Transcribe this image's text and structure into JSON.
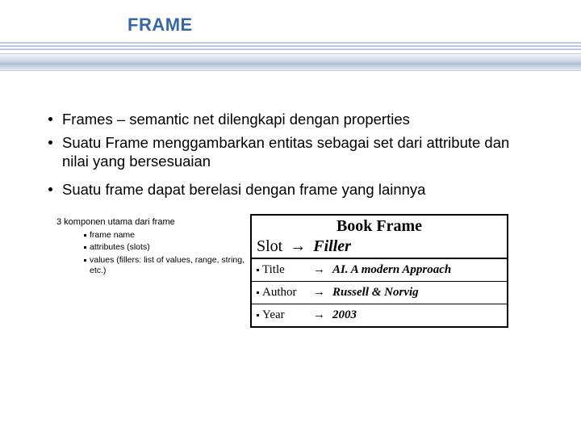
{
  "title": "FRAME",
  "bullets": [
    "Frames – semantic net dilengkapi dengan properties",
    "Suatu Frame menggambarkan entitas sebagai set dari attribute dan nilai yang bersesuaian",
    "Suatu frame dapat berelasi dengan frame yang lainnya"
  ],
  "components": {
    "heading": "3 komponen utama dari frame",
    "items": [
      "frame name",
      "attributes (slots)",
      "values (fillers: list of values, range, string, etc.)"
    ]
  },
  "box": {
    "title": "Book Frame",
    "header": {
      "slot": "Slot",
      "arrow": "→",
      "filler": "Filler"
    },
    "rows": [
      {
        "slot": "Title",
        "arrow": "→",
        "filler": "AI. A modern Approach"
      },
      {
        "slot": "Author",
        "arrow": "→",
        "filler": "Russell & Norvig"
      },
      {
        "slot": "Year",
        "arrow": "→",
        "filler": "2003"
      }
    ]
  }
}
